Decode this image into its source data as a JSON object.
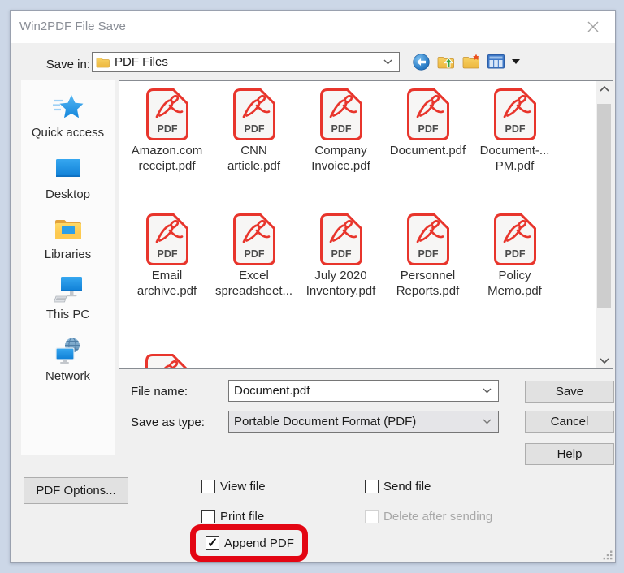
{
  "window": {
    "title": "Win2PDF File Save",
    "close_icon": "close-x"
  },
  "toolbar": {
    "save_in_label": "Save in:",
    "save_in_value": "PDF Files",
    "icons": {
      "folder": "yellow-folder-icon",
      "back": "go-to-last-folder-visited-icon",
      "up_one_level": "up-one-level-icon",
      "create_new_folder": "create-new-folder-icon",
      "view_menu": "view-menu-icon"
    }
  },
  "sidebar": {
    "items": [
      {
        "label": "Quick access",
        "icon": "quick-access-star-icon"
      },
      {
        "label": "Desktop",
        "icon": "desktop-monitor-icon"
      },
      {
        "label": "Libraries",
        "icon": "libraries-folder-icon"
      },
      {
        "label": "This PC",
        "icon": "this-pc-computer-icon"
      },
      {
        "label": "Network",
        "icon": "network-globe-icon"
      }
    ]
  },
  "file_list": {
    "pdf_badge": "PDF",
    "files": [
      {
        "line1": "Amazon.com",
        "line2": "receipt.pdf"
      },
      {
        "line1": "CNN",
        "line2": "article.pdf"
      },
      {
        "line1": "Company",
        "line2": "Invoice.pdf"
      },
      {
        "line1": "Document.pdf",
        "line2": ""
      },
      {
        "line1": "Document-...",
        "line2": "PM.pdf"
      },
      {
        "line1": "Email",
        "line2": "archive.pdf"
      },
      {
        "line1": "Excel",
        "line2": "spreadsheet..."
      },
      {
        "line1": "July 2020",
        "line2": "Inventory.pdf"
      },
      {
        "line1": "Personnel",
        "line2": "Reports.pdf"
      },
      {
        "line1": "Policy",
        "line2": "Memo.pdf"
      }
    ]
  },
  "form": {
    "file_name_label": "File name:",
    "file_name_value": "Document.pdf",
    "save_as_type_label": "Save as type:",
    "save_as_type_value": "Portable Document Format (PDF)"
  },
  "actions": {
    "save": "Save",
    "cancel": "Cancel",
    "help": "Help",
    "pdf_options": "PDF Options..."
  },
  "options": {
    "view_file": {
      "label": "View file",
      "checked": false,
      "disabled": false
    },
    "send_file": {
      "label": "Send file",
      "checked": false,
      "disabled": false
    },
    "print_file": {
      "label": "Print file",
      "checked": false,
      "disabled": false
    },
    "delete_after_sending": {
      "label": "Delete after sending",
      "checked": false,
      "disabled": true
    },
    "append_pdf": {
      "label": "Append PDF",
      "checked": true,
      "disabled": false,
      "highlighted": true
    }
  },
  "colors": {
    "pdf_icon_red": "#e8352c",
    "highlight_red": "#e30613",
    "dialog_bg": "#f0f0f0",
    "outer_bg": "#ccd7e7",
    "folder_yellow": "#fbbf45",
    "accent_blue": "#2196f3"
  }
}
